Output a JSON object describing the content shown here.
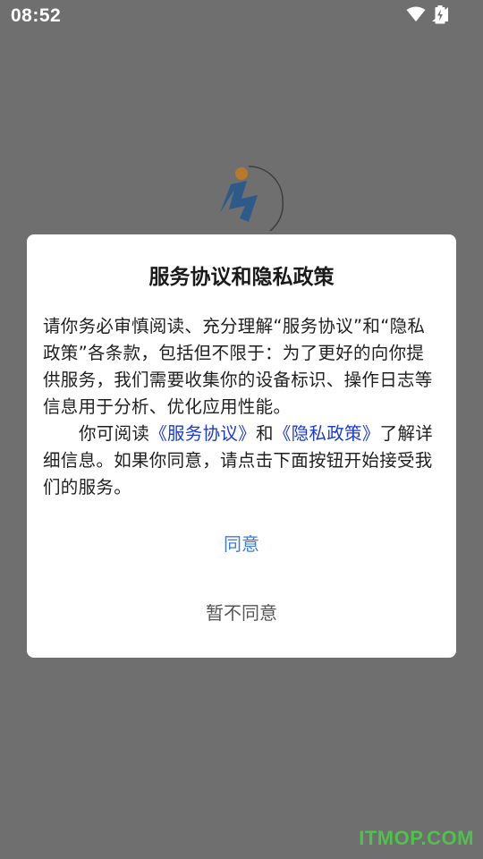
{
  "status_bar": {
    "time": "08:52",
    "icons": [
      "wifi-icon",
      "signal-icon",
      "battery-charging-icon"
    ]
  },
  "app_logo": "app-logo",
  "dialog": {
    "title": "服务协议和隐私政策",
    "paragraph1": "请你务必审慎阅读、充分理解“服务协议”和“隐私政策”各条款，包括但不限于：为了更好的向你提供服务，我们需要收集你的设备标识、操作日志等信息用于分析、优化应用性能。",
    "paragraph2_prefix": "你可阅读",
    "service_agreement_link": "《服务协议》",
    "conjunction": "和",
    "privacy_policy_link": "《隐私政策》",
    "paragraph2_suffix": "了解详细信息。如果你同意，请点击下面按钮开始接受我们的服务。",
    "agree_label": "同意",
    "disagree_label": "暂不同意"
  },
  "watermark": "ITMOP.COM",
  "colors": {
    "overlay": "#6f6f6f",
    "link": "#1a3ad6",
    "agree": "#3a7be0",
    "watermark": "#4ec24a"
  }
}
